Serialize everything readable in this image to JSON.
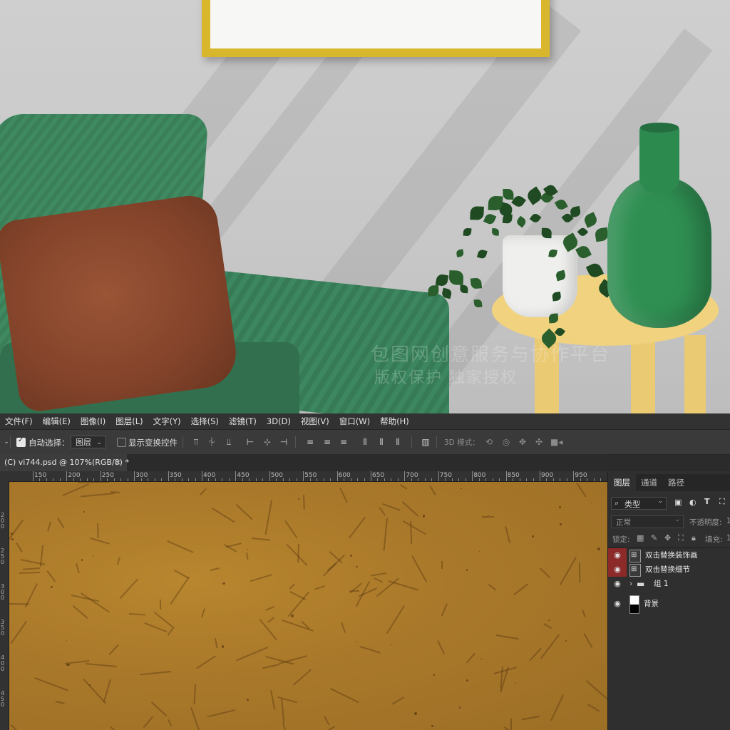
{
  "menu": [
    "文件(F)",
    "编辑(E)",
    "图像(I)",
    "图层(L)",
    "文字(Y)",
    "选择(S)",
    "滤镜(T)",
    "3D(D)",
    "视图(V)",
    "窗口(W)",
    "帮助(H)"
  ],
  "options": {
    "auto_select_label": "自动选择：",
    "auto_select_checked": true,
    "auto_select_target": "图层",
    "show_transform_label": "显示变换控件",
    "show_transform_checked": false,
    "mode_3d_label": "3D 模式："
  },
  "document_tab": {
    "title": "(C) vi744.psd @ 107%(RGB/8) *",
    "close": "×"
  },
  "ruler": {
    "h_labels": [
      "150",
      "200",
      "250",
      "300",
      "350",
      "400",
      "450",
      "500",
      "550",
      "600",
      "650",
      "700",
      "750",
      "800",
      "850",
      "900",
      "950"
    ],
    "v_labels": [
      "0",
      "2\n0\n0",
      "2\n5\n0",
      "3\n0\n0",
      "3\n5\n0",
      "4\n0\n0",
      "4\n5\n0"
    ]
  },
  "layers_panel": {
    "tabs": [
      "图层",
      "通道",
      "路径"
    ],
    "filter_label": "类型",
    "blend_mode": "正常",
    "opacity_label": "不透明度:",
    "opacity_value": "1",
    "lock_label": "锁定:",
    "fill_label": "填充:",
    "fill_value": "1",
    "layers": [
      {
        "name": "双击替换装饰画",
        "type": "smart",
        "eye_highlight": true
      },
      {
        "name": "双击替换细节",
        "type": "smart",
        "eye_highlight": true
      },
      {
        "name": "组 1",
        "type": "group",
        "eye_highlight": false
      },
      {
        "name": "背景",
        "type": "background",
        "eye_highlight": false
      }
    ]
  },
  "watermark": {
    "line1": "包图网创意服务与协作平台",
    "line2": "版权保护 独家授权"
  },
  "colors": {
    "menubar_bg": "#323232",
    "options_bg": "#3a3a3a",
    "panel_bg": "#2f2f2f",
    "canvas_texture": "#a9782a",
    "eye_highlight": "#8c2a2a"
  }
}
